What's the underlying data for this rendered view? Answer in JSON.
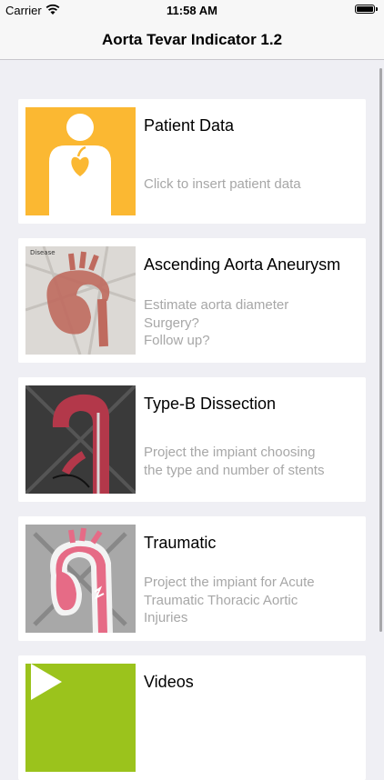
{
  "status_bar": {
    "carrier": "Carrier",
    "time": "11:58 AM"
  },
  "nav": {
    "title": "Aorta Tevar Indicator 1.2"
  },
  "cards": [
    {
      "title": "Patient Data",
      "subtitle": [
        "Click to insert patient data"
      ],
      "thumb_icon": "patient-heart-icon",
      "thumb_color": "#fbb832"
    },
    {
      "title": "Ascending Aorta Aneurysm",
      "subtitle": [
        "Estimate aorta diameter",
        "Surgery?",
        "Follow up?"
      ],
      "thumb_icon": "aorta-aneurysm-image",
      "thumb_label": "Disease"
    },
    {
      "title": "Type-B Dissection",
      "subtitle": [
        "Project the impiant choosing",
        "the type and number of stents"
      ],
      "thumb_icon": "dissection-image"
    },
    {
      "title": "Traumatic",
      "subtitle": [
        "Project the impiant for Acute",
        "Traumatic Thoracic Aortic",
        "Injuries"
      ],
      "thumb_icon": "traumatic-image"
    },
    {
      "title": "Videos",
      "subtitle": [],
      "thumb_icon": "play-icon",
      "thumb_color": "#9bc31c"
    }
  ]
}
